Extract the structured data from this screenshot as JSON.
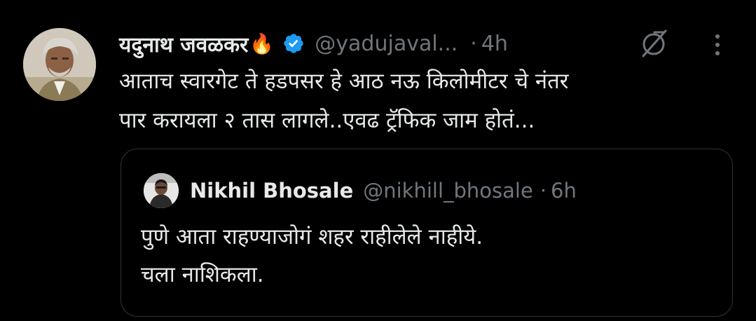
{
  "tweet": {
    "author_name": "यदुनाथ जवळकर",
    "name_emoji": "🔥",
    "handle": "@yadujaval...",
    "separator": "·",
    "time": "4h",
    "text_lines": [
      "आताच स्वारगेट ते हडपसर हे आठ नऊ  किलोमीटर चे नंतर",
      "पार करायला २ तास लागले..एवढ ट्रॅफिक जाम होतं..."
    ],
    "icons": {
      "verified": "verified-badge-icon",
      "grok": "grok-icon",
      "more": "more-options-icon"
    },
    "colors": {
      "background": "#000000",
      "text": "#e7e9ea",
      "secondary": "#71767b",
      "verified": "#1d9bf0",
      "border": "#2f3336"
    }
  },
  "quote": {
    "author_name": "Nikhil Bhosale",
    "handle": "@nikhill_bhosale",
    "separator": "·",
    "time": "6h",
    "text_lines": [
      "पुणे आता राहण्याजोगं शहर राहीलेले नाहीये.",
      "चला नाशिकला."
    ]
  }
}
